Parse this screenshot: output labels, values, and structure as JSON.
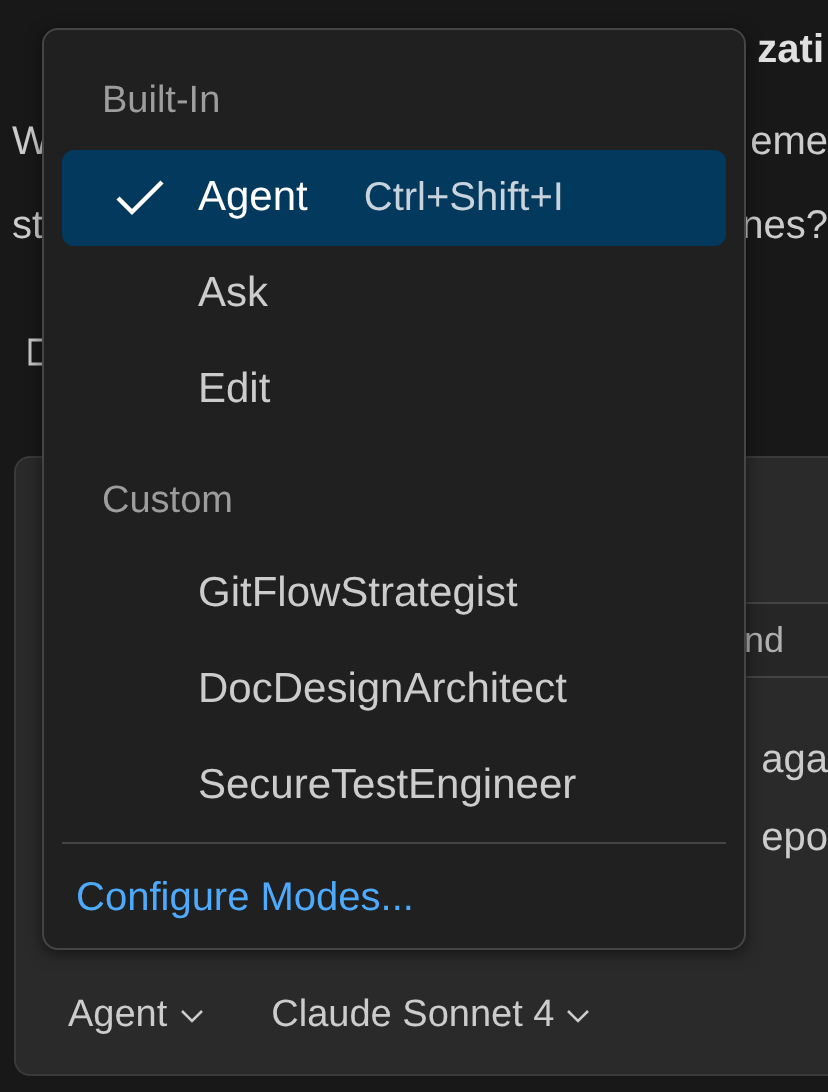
{
  "chat": {
    "heading_fragment": "zati",
    "question_lines": [
      {
        "start": "W",
        "end": "eme"
      },
      {
        "start": "st",
        "end": "nes?"
      }
    ]
  },
  "input_panel": {
    "toolbar_fragment": "nd",
    "text_fragments": [
      "aga",
      "epo"
    ],
    "mode_picker": "Agent",
    "model_picker": "Claude Sonnet 4"
  },
  "mode_menu": {
    "sections": [
      {
        "title": "Built-In",
        "items": [
          {
            "label": "Agent",
            "shortcut": "Ctrl+Shift+I",
            "selected": true
          },
          {
            "label": "Ask",
            "selected": false
          },
          {
            "label": "Edit",
            "selected": false
          }
        ]
      },
      {
        "title": "Custom",
        "items": [
          {
            "label": "GitFlowStrategist",
            "selected": false
          },
          {
            "label": "DocDesignArchitect",
            "selected": false
          },
          {
            "label": "SecureTestEngineer",
            "selected": false
          }
        ]
      }
    ],
    "footer_link": "Configure Modes..."
  }
}
